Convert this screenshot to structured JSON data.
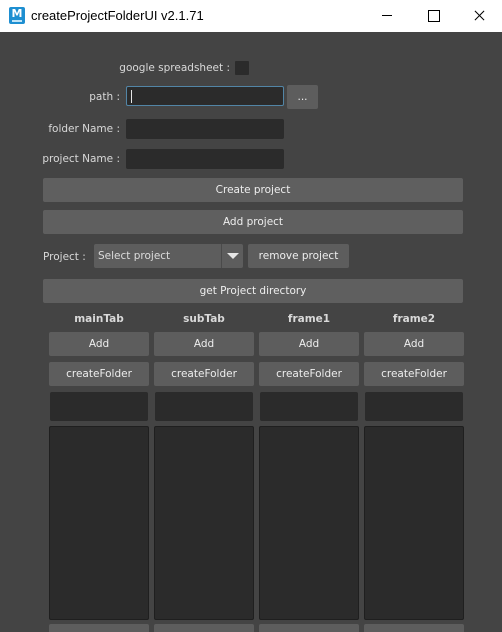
{
  "window": {
    "title": "createProjectFolderUI v2.1.71",
    "icon_letter": "M"
  },
  "form": {
    "google_spreadsheet_label": "google spreadsheet :",
    "google_spreadsheet_checked": false,
    "path_label": "path :",
    "path_value": "",
    "browse_label": "...",
    "folder_name_label": "folder Name :",
    "folder_name_value": "",
    "project_name_label": "project Name :",
    "project_name_value": ""
  },
  "actions": {
    "create_project": "Create project",
    "add_project": "Add project",
    "project_label": "Project :",
    "project_select_value": "Select project",
    "remove_project": "remove project",
    "get_project_directory": "get Project directory"
  },
  "columns": [
    {
      "name": "mainTab",
      "add_label": "Add",
      "create_label": "createFolder",
      "field_value": "",
      "items": []
    },
    {
      "name": "subTab",
      "add_label": "Add",
      "create_label": "createFolder",
      "field_value": "",
      "items": []
    },
    {
      "name": "frame1",
      "add_label": "Add",
      "create_label": "createFolder",
      "field_value": "",
      "items": []
    },
    {
      "name": "frame2",
      "add_label": "Add",
      "create_label": "createFolder",
      "field_value": "",
      "items": []
    }
  ],
  "colors": {
    "window_bg": "#444444",
    "field_bg": "#2b2b2b",
    "button_bg": "#5d5d5d",
    "focus_border": "#5285a6",
    "app_icon": "#1e8fd1"
  }
}
